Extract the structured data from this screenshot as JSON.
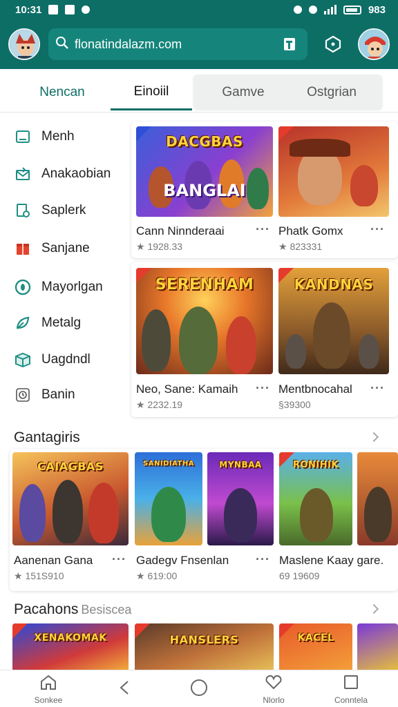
{
  "status_bar": {
    "time": "10:31",
    "battery": "983"
  },
  "header": {
    "search_text": "flonatindalazm.com"
  },
  "tabs": [
    {
      "label": "Nencan"
    },
    {
      "label": "Einoiil"
    },
    {
      "label": "Gamve"
    },
    {
      "label": "Ostgrian"
    }
  ],
  "sidebar": {
    "items": [
      {
        "label": "Menh",
        "icon": "tablet-icon"
      },
      {
        "label": "Anakaobian",
        "icon": "mail-icon"
      },
      {
        "label": "Saplerk",
        "icon": "file-settings-icon"
      },
      {
        "label": "Sanjane",
        "icon": "gift-icon"
      },
      {
        "label": "Mayorlgan",
        "icon": "target-icon"
      },
      {
        "label": "Metalg",
        "icon": "leaf-icon"
      },
      {
        "label": "Uagdndl",
        "icon": "box-icon"
      },
      {
        "label": "Banin",
        "icon": "clock-icon"
      }
    ]
  },
  "featured": [
    {
      "title": "Cann Ninnderaai",
      "rating": "1928.33",
      "art_title": "DACGBAS",
      "art_sub": "BANGLAI"
    },
    {
      "title": "Phatk Gomx",
      "rating": "823331",
      "art_title": "",
      "art_sub": ""
    },
    {
      "title": "Neo, Sane: Kamaih",
      "rating": "2232.19",
      "art_title": "SERENHAM",
      "art_sub": ""
    },
    {
      "title": "Mentbnocahal",
      "rating": "§39300",
      "art_title": "KANDNAS",
      "art_sub": ""
    }
  ],
  "section1": {
    "title": "Gantagiris",
    "items": [
      {
        "title": "Aanenan Gana",
        "rating": "151S910",
        "art_title": "CAIAGBAS"
      },
      {
        "title": "Gadegv Fnsenlan",
        "rating": "619:00",
        "art_title": "SANIDIATHA",
        "art_title2": "MYNBAA"
      },
      {
        "title": "Maslene Kaay gare.",
        "rating": "69 19609",
        "art_title": "RONIHIK"
      }
    ]
  },
  "section2": {
    "title": "Pacahons",
    "subtitle": "Besiscea",
    "art_titles": [
      "XENAKOMAK",
      "HANSLERS",
      "KACEL"
    ]
  },
  "bottom_nav": [
    {
      "label": "Sonkee",
      "icon": "home-icon"
    },
    {
      "label": "",
      "icon": "back-icon"
    },
    {
      "label": "",
      "icon": "circle-home-icon"
    },
    {
      "label": "Nlorlo",
      "icon": "heart-icon"
    },
    {
      "label": "Conntela",
      "icon": "square-icon"
    }
  ],
  "colors": {
    "brand": "#0d6e66",
    "accent": "#15857b"
  }
}
